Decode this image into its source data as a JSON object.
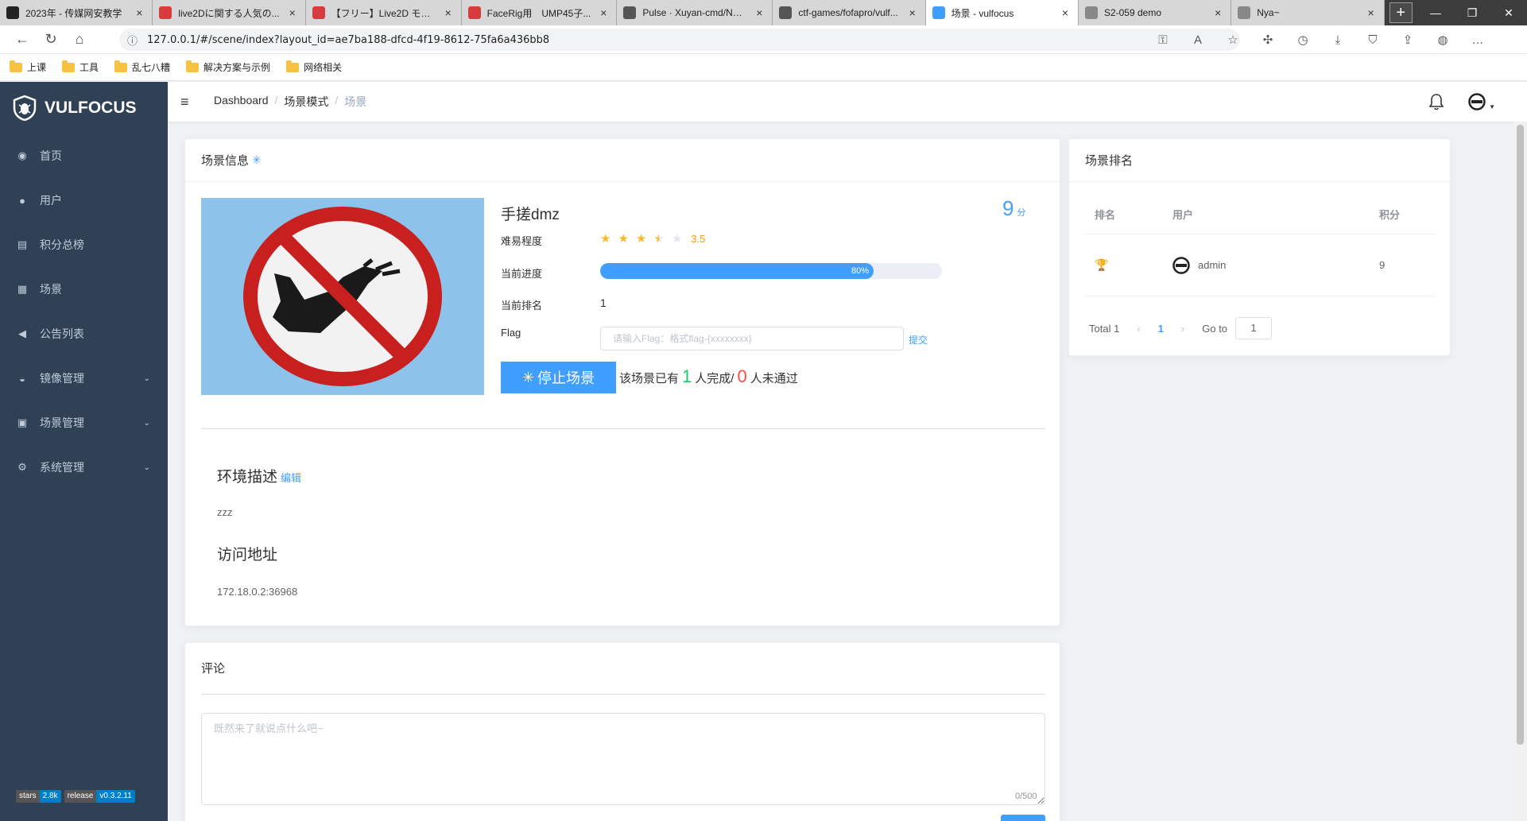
{
  "browser": {
    "tabs": [
      {
        "title": "2023年 - 传媒网安教学",
        "color": "#222222",
        "glyph": "graduation-cap-icon"
      },
      {
        "title": "live2Dに関する人気の...",
        "color": "#d83b3b",
        "glyph": "w-icon"
      },
      {
        "title": "【フリー】Live2D モデ...",
        "color": "#d83b3b",
        "glyph": "w-icon"
      },
      {
        "title": "FaceRig用　UMP45子...",
        "color": "#d83b3b",
        "glyph": "w-icon"
      },
      {
        "title": "Pulse · Xuyan-cmd/Net...",
        "color": "#555555",
        "glyph": "github-icon"
      },
      {
        "title": "ctf-games/fofapro/vulf...",
        "color": "#555555",
        "glyph": "github-icon"
      },
      {
        "title": "场景 - vulfocus",
        "color": "#409eff",
        "glyph": "shield-icon"
      },
      {
        "title": "S2-059 demo",
        "color": "#888888",
        "glyph": "page-icon"
      },
      {
        "title": "Nya~",
        "color": "#888888",
        "glyph": "page-icon"
      }
    ],
    "url": "127.0.0.1/#/scene/index?layout_id=ae7ba188-dfcd-4f19-8612-75fa6a436bb8",
    "bookmarks": [
      "上课",
      "工具",
      "乱七八糟",
      "解决方案与示例",
      "网络相关"
    ]
  },
  "sidebar": {
    "brand": "VULFOCUS",
    "items": [
      {
        "label": "首页",
        "icon": "dashboard-icon",
        "glyph": "◉",
        "expandable": false
      },
      {
        "label": "用户",
        "icon": "user-icon",
        "glyph": "●",
        "expandable": false
      },
      {
        "label": "积分总榜",
        "icon": "document-icon",
        "glyph": "▤",
        "expandable": false
      },
      {
        "label": "场景",
        "icon": "grid-icon",
        "glyph": "▦",
        "expandable": false
      },
      {
        "label": "公告列表",
        "icon": "megaphone-icon",
        "glyph": "◀",
        "expandable": false
      },
      {
        "label": "镜像管理",
        "icon": "docker-icon",
        "glyph": "◒",
        "expandable": true
      },
      {
        "label": "场景管理",
        "icon": "scene-icon",
        "glyph": "▣",
        "expandable": true
      },
      {
        "label": "系统管理",
        "icon": "gear-icon",
        "glyph": "⚙",
        "expandable": true
      }
    ],
    "badges": [
      {
        "key": "stars",
        "value": "2.8k"
      },
      {
        "key": "release",
        "value": "v0.3.2.11"
      }
    ]
  },
  "navbar": {
    "breadcrumb": [
      "Dashboard",
      "场景模式",
      "场景"
    ]
  },
  "scene": {
    "header": "场景信息",
    "title": "手搓dmz",
    "score": "9",
    "score_unit": "分",
    "difficulty_label": "难易程度",
    "difficulty_value": "3.5",
    "difficulty_rating": 3.5,
    "difficulty_max": 5,
    "progress_label": "当前进度",
    "progress_text": "80%",
    "progress_value": 0.8,
    "rank_label": "当前排名",
    "rank_value": "1",
    "flag_label": "Flag",
    "flag_placeholder": "请输入Flag：格式flag-{xxxxxxxx}",
    "submit_label": "提交",
    "stop_button": "停止场景",
    "stats_prefix": "该场景已有",
    "completed": "1",
    "completed_suffix": "人完成/",
    "failed": "0",
    "failed_suffix": "人未通过",
    "env_title": "环境描述",
    "edit_label": "编辑",
    "env_text": "zzz",
    "addr_title": "访问地址",
    "addr_text": "172.18.0.2:36968"
  },
  "ranking": {
    "header": "场景排名",
    "columns": [
      "排名",
      "用户",
      "积分"
    ],
    "rows": [
      {
        "rank_icon": "trophy-icon",
        "user": "admin",
        "score": "9"
      }
    ],
    "total": "Total 1",
    "current_page": "1",
    "goto_label": "Go to",
    "goto_value": "1"
  },
  "comments": {
    "header": "评论",
    "placeholder": "既然来了就说点什么吧~",
    "counter": "0/500"
  },
  "colors": {
    "sidebar_bg": "#304156",
    "primary": "#409eff",
    "success": "#13ce66",
    "danger": "#ff4949",
    "star": "#f7ba2a"
  }
}
